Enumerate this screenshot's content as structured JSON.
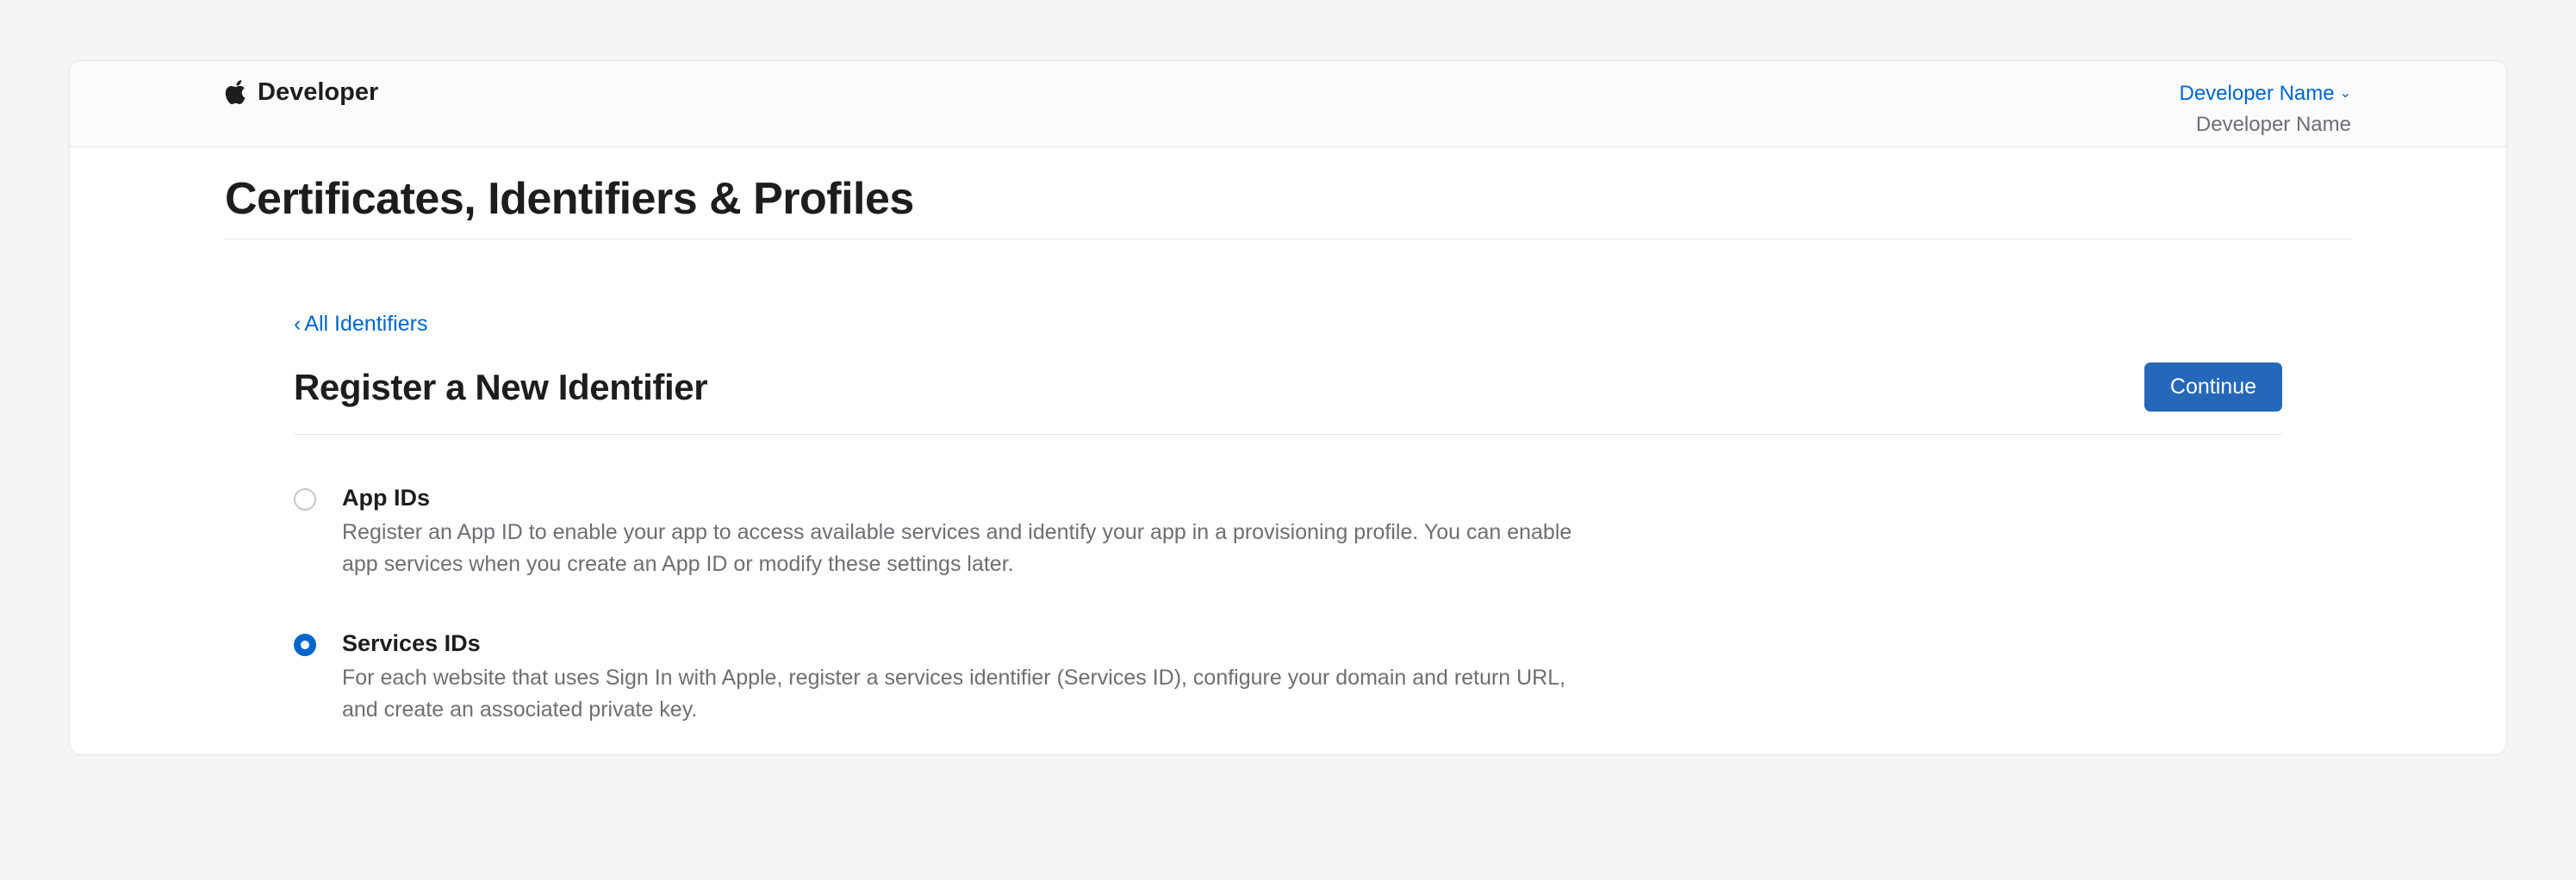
{
  "header": {
    "brand": "Developer",
    "account_name": "Developer Name",
    "account_sub": "Developer Name"
  },
  "page": {
    "title": "Certificates, Identifiers & Profiles",
    "back_link": "All Identifiers",
    "section_title": "Register a New Identifier",
    "continue_label": "Continue"
  },
  "options": [
    {
      "id": "app-ids",
      "title": "App IDs",
      "description": "Register an App ID to enable your app to access available services and identify your app in a provisioning profile. You can enable app services when you create an App ID or modify these settings later.",
      "selected": false
    },
    {
      "id": "services-ids",
      "title": "Services IDs",
      "description": "For each website that uses Sign In with Apple, register a services identifier (Services ID), configure your domain and return URL, and create an associated private key.",
      "selected": true
    }
  ]
}
